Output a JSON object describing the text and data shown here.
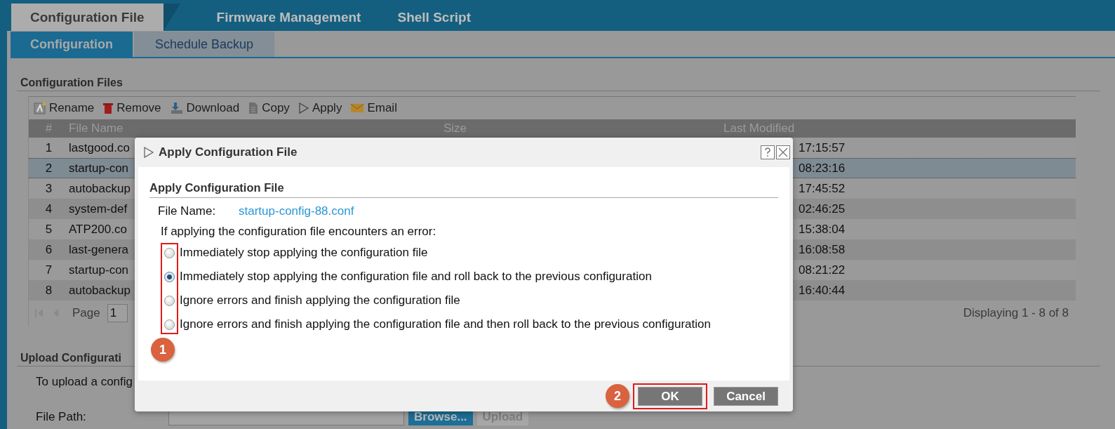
{
  "tabs": [
    {
      "label": "Configuration File",
      "selected": true
    },
    {
      "label": "Firmware Management",
      "selected": false
    },
    {
      "label": "Shell Script",
      "selected": false
    }
  ],
  "subtabs": [
    {
      "label": "Configuration",
      "selected": true
    },
    {
      "label": "Schedule Backup",
      "selected": false
    }
  ],
  "section_title": "Configuration Files",
  "toolbar": [
    {
      "label": "Rename",
      "kind": "rename"
    },
    {
      "label": "Remove",
      "kind": "remove"
    },
    {
      "label": "Download",
      "kind": "download"
    },
    {
      "label": "Copy",
      "kind": "copy"
    },
    {
      "label": "Apply",
      "kind": "apply"
    },
    {
      "label": "Email",
      "kind": "email"
    }
  ],
  "table": {
    "columns": [
      "#",
      "File Name",
      "Size",
      "Last Modified"
    ],
    "rows": [
      {
        "index": "1",
        "file_name": "lastgood.co",
        "last_modified": "17:15:57",
        "selected": false
      },
      {
        "index": "2",
        "file_name": "startup-con",
        "last_modified": "08:23:16",
        "selected": true
      },
      {
        "index": "3",
        "file_name": "autobackup",
        "last_modified": "17:45:52",
        "selected": false
      },
      {
        "index": "4",
        "file_name": "system-def",
        "last_modified": "02:46:25",
        "selected": false
      },
      {
        "index": "5",
        "file_name": "ATP200.co",
        "last_modified": "15:38:04",
        "selected": false
      },
      {
        "index": "6",
        "file_name": "last-genera",
        "last_modified": "16:08:58",
        "selected": false
      },
      {
        "index": "7",
        "file_name": "startup-con",
        "last_modified": "08:21:22",
        "selected": false
      },
      {
        "index": "8",
        "file_name": "autobackup",
        "last_modified": "16:40:44",
        "selected": false
      }
    ]
  },
  "pager": {
    "page_label": "Page",
    "page": "1",
    "summary": "Displaying 1 - 8 of 8"
  },
  "upload": {
    "title": "Upload Configurati",
    "text": "To upload a config",
    "file_path_label": "File Path:",
    "buttons": [
      {
        "label": "Browse...",
        "disabled": false
      },
      {
        "label": "Upload",
        "disabled": true
      }
    ]
  },
  "dialog": {
    "title": "Apply Configuration File",
    "section": "Apply Configuration File",
    "file_name_label": "File Name:",
    "file_name": "startup-config-88.conf",
    "prompt": "If applying the configuration file encounters an error:",
    "options_highlighted": true,
    "options": [
      {
        "label": "Immediately stop applying the configuration file",
        "selected": false
      },
      {
        "label": "Immediately stop applying the configuration file and roll back to the previous configuration",
        "selected": true
      },
      {
        "label": "Ignore errors and finish applying the configuration file",
        "selected": false
      },
      {
        "label": "Ignore errors and finish applying the configuration file and then roll back to the previous configuration",
        "selected": false
      }
    ],
    "buttons": [
      {
        "label": "OK",
        "highlighted": true
      },
      {
        "label": "Cancel",
        "highlighted": false
      }
    ]
  },
  "annotations": [
    {
      "label": "1"
    },
    {
      "label": "2"
    }
  ]
}
